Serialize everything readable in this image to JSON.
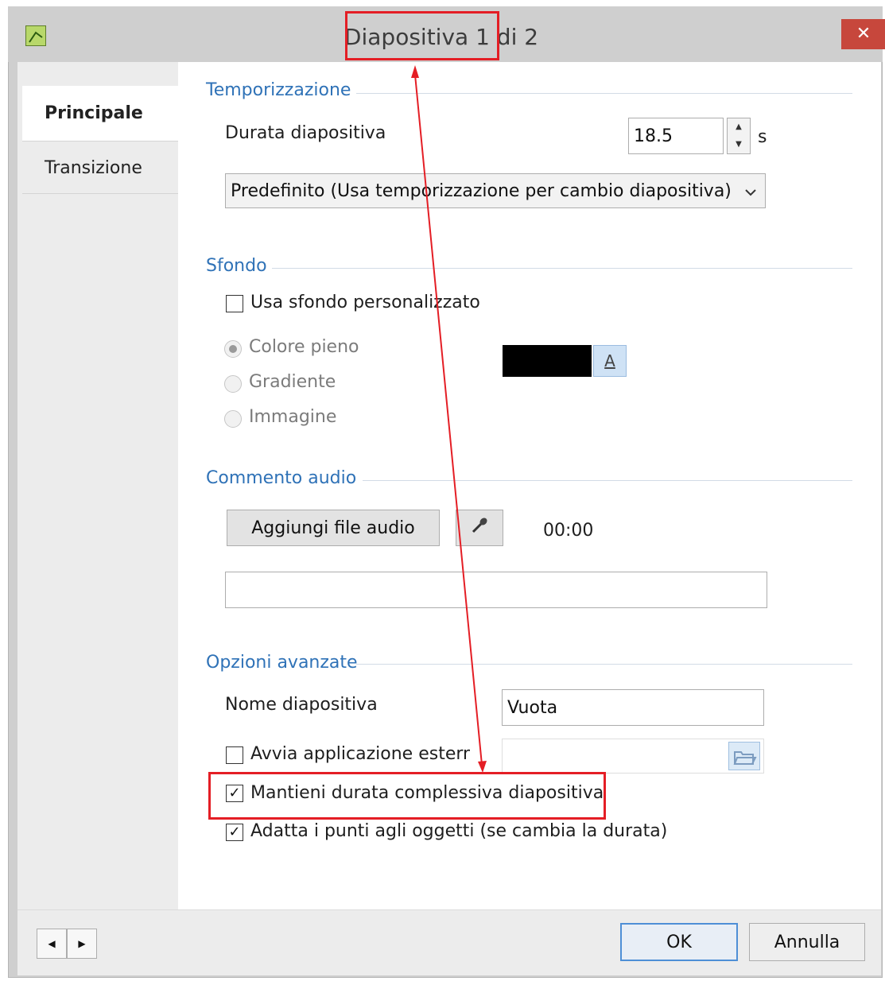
{
  "window": {
    "title": "Diapositiva 1 di 2",
    "close_icon": "close-icon",
    "app_icon": "app-icon"
  },
  "tabs": [
    {
      "label": "Principale",
      "active": true
    },
    {
      "label": "Transizione",
      "active": false
    }
  ],
  "sections": {
    "temporizzazione": {
      "title": "Temporizzazione",
      "durata_label": "Durata diapositiva",
      "durata_value": "18.5",
      "durata_unit": "s",
      "mode_selected": "Predefinito (Usa temporizzazione per cambio diapositiva)"
    },
    "sfondo": {
      "title": "Sfondo",
      "custom_label": "Usa sfondo personalizzato",
      "custom_checked": false,
      "radio_solid": "Colore pieno",
      "radio_gradient": "Gradiente",
      "radio_image": "Immagine",
      "selected": "Colore pieno",
      "color": "#000000",
      "color_button_glyph": "A"
    },
    "audio": {
      "title": "Commento audio",
      "add_button": "Aggiungi file audio",
      "time": "00:00",
      "file_value": ""
    },
    "advanced": {
      "title": "Opzioni avanzate",
      "name_label": "Nome diapositiva",
      "name_value": "Vuota",
      "external_label": "Avvia applicazione esterna",
      "external_checked": false,
      "keep_duration_label": "Mantieni durata complessiva diapositiva",
      "keep_duration_checked": true,
      "adapt_points_label": "Adatta i punti agli oggetti (se cambia la durata)",
      "adapt_points_checked": true
    }
  },
  "footer": {
    "ok": "OK",
    "cancel": "Annulla"
  },
  "colors": {
    "section_title": "#2f72b7",
    "annotation": "#e41e25",
    "close_button": "#c7473c"
  }
}
